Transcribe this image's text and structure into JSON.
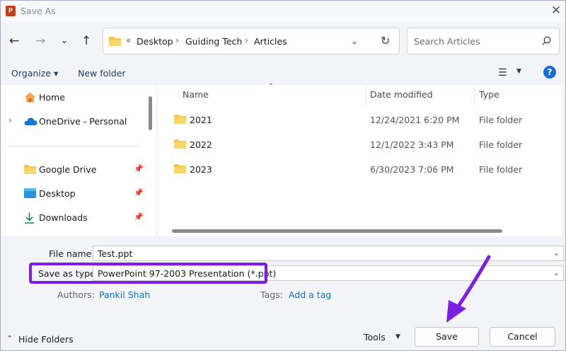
{
  "window": {
    "title": "Save As",
    "app_icon_letter": "P"
  },
  "address_bar": {
    "overflow": "«",
    "crumbs": [
      "Desktop",
      "Guiding Tech",
      "Articles"
    ]
  },
  "search": {
    "placeholder": "Search Articles"
  },
  "command_bar": {
    "organize_label": "Organize ▾",
    "new_folder_label": "New folder",
    "help_label": "?"
  },
  "nav_pane": {
    "items": [
      {
        "label": "Home",
        "icon": "home-icon"
      },
      {
        "label": "OneDrive - Personal",
        "icon": "cloud-icon"
      },
      {
        "label": "Google Drive",
        "icon": "folder-icon",
        "pinned": true
      },
      {
        "label": "Desktop",
        "icon": "desktop-icon",
        "pinned": true
      },
      {
        "label": "Downloads",
        "icon": "download-icon",
        "pinned": true
      }
    ]
  },
  "file_list": {
    "columns": [
      "Name",
      "Date modified",
      "Type"
    ],
    "rows": [
      {
        "name": "2021",
        "date": "12/24/2021 6:20 PM",
        "type": "File folder"
      },
      {
        "name": "2022",
        "date": "12/1/2022 3:43 PM",
        "type": "File folder"
      },
      {
        "name": "2023",
        "date": "6/30/2023 7:06 PM",
        "type": "File folder"
      }
    ]
  },
  "form": {
    "file_name_label": "File name:",
    "file_name_value": "Test.ppt",
    "save_type_label": "Save as type:",
    "save_type_value": "PowerPoint 97-2003 Presentation (*.ppt)",
    "authors_label": "Authors:",
    "authors_value": "Pankil Shah",
    "tags_label": "Tags:",
    "tags_value": "Add a tag"
  },
  "footer": {
    "hide_folders_label": "Hide Folders",
    "tools_label": "Tools",
    "save_label": "Save",
    "cancel_label": "Cancel"
  },
  "colors": {
    "highlight": "#7c1fe3",
    "accent": "#1a6cc8",
    "folder": "#f4c44e"
  }
}
